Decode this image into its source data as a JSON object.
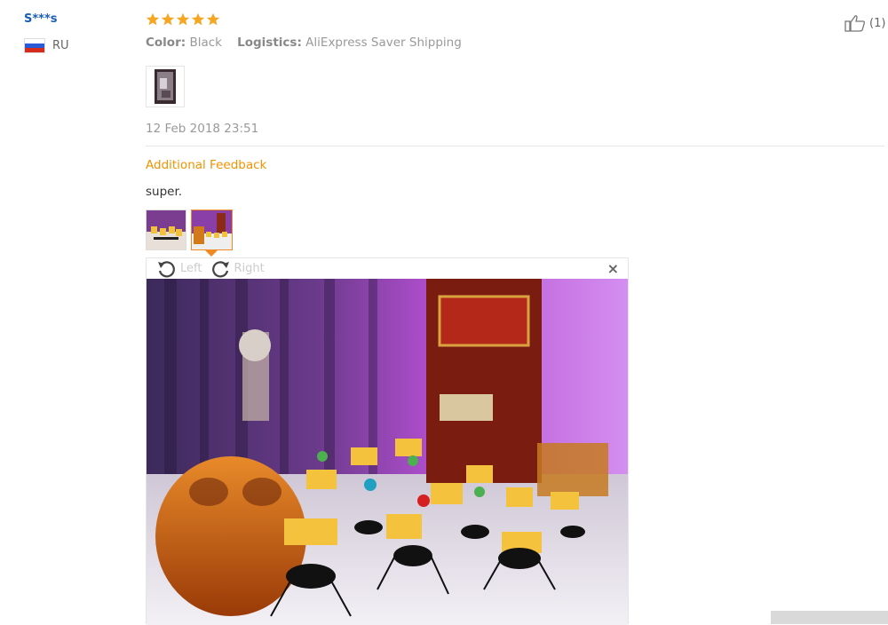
{
  "reviewer": {
    "name": "S***s",
    "country": "RU"
  },
  "review": {
    "rating": 5,
    "color_label": "Color:",
    "color_value": "Black",
    "logistics_label": "Logistics:",
    "logistics_value": "AliExpress Saver Shipping",
    "date": "12 Feb 2018 23:51"
  },
  "additional": {
    "heading": "Additional Feedback",
    "text": "super."
  },
  "viewer": {
    "rotate_left": "Left",
    "rotate_right": "Right",
    "close": "×"
  },
  "helpful": {
    "count": "(1)"
  },
  "colors": {
    "accent": "#f29200",
    "link": "#1a5fb4",
    "star": "#f5a623"
  }
}
